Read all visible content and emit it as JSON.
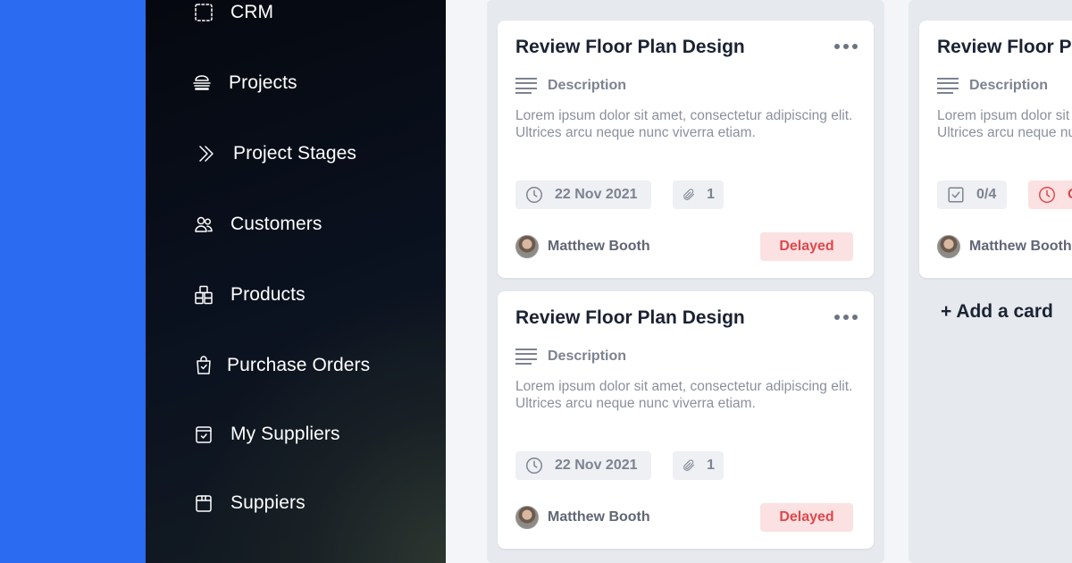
{
  "sidebar": {
    "items": [
      {
        "label": "CRM",
        "icon": "dashed-square-icon"
      },
      {
        "label": "Projects",
        "icon": "layers-icon"
      },
      {
        "label": "Project Stages",
        "icon": "double-chevron-right-icon"
      },
      {
        "label": "Customers",
        "icon": "users-icon"
      },
      {
        "label": "Products",
        "icon": "boxes-icon"
      },
      {
        "label": "Purchase Orders",
        "icon": "shopping-bag-check-icon"
      },
      {
        "label": "My Suppliers",
        "icon": "package-check-icon"
      },
      {
        "label": "Suppiers",
        "icon": "package-icon"
      }
    ]
  },
  "board": {
    "columns": [
      {
        "cards": [
          {
            "title": "Review Floor Plan Design",
            "description_label": "Description",
            "description": "Lorem ipsum dolor sit amet, consectetur adipiscing elit. Ultrices arcu neque nunc viverra etiam.",
            "date": "22 Nov 2021",
            "attachments": "1",
            "assignee": "Matthew Booth",
            "status": "Delayed"
          },
          {
            "title": "Review Floor Plan Design",
            "description_label": "Description",
            "description": "Lorem ipsum dolor sit amet, consectetur adipiscing elit. Ultrices arcu neque nunc viverra etiam.",
            "date": "22 Nov 2021",
            "attachments": "1",
            "assignee": "Matthew Booth",
            "status": "Delayed"
          }
        ]
      },
      {
        "cards": [
          {
            "title": "Review Floor Plan Design",
            "description_label": "Description",
            "description": "Lorem ipsum dolor sit amet, consectetur adipiscing elit. Ultrices arcu neque nunc viverra etiam.",
            "checklist": "0/4",
            "date_partial": "O",
            "assignee": "Matthew Booth"
          }
        ],
        "add_card_label": "+ Add a card"
      }
    ]
  },
  "colors": {
    "accent_blue": "#2a6bf2",
    "danger": "#e0484b",
    "danger_bg": "#fbe1e1"
  }
}
